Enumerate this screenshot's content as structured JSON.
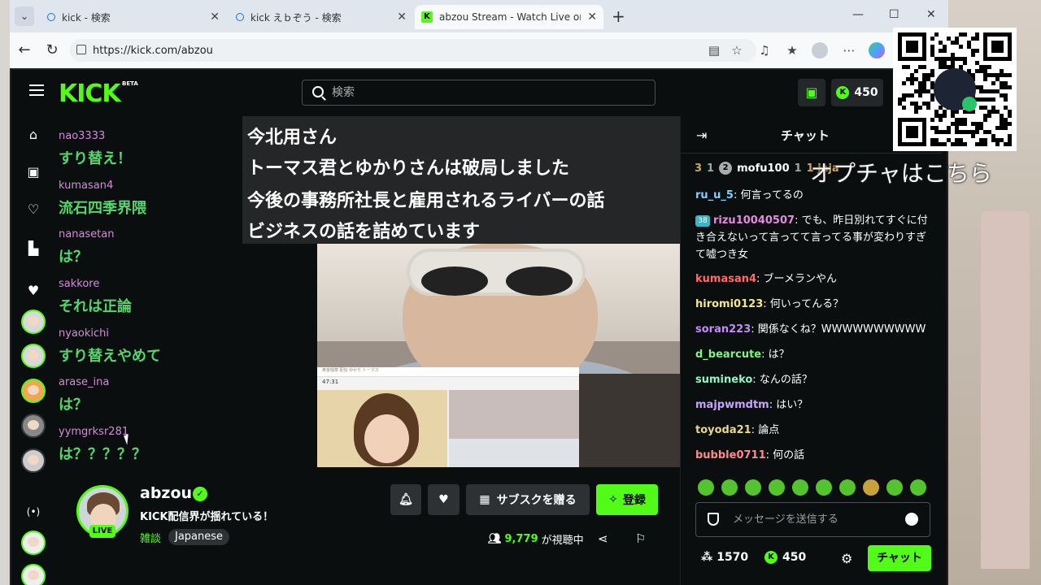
{
  "browser": {
    "tabs": [
      {
        "title": "kick - 検索",
        "active": false
      },
      {
        "title": "kick えｂぞう - 検索",
        "active": false
      },
      {
        "title": "abzou Stream - Watch Live on Kick",
        "active": true
      }
    ],
    "new_tab": "+",
    "url": "https://kick.com/abzou",
    "window_controls": [
      "—",
      "☐",
      "✕"
    ]
  },
  "header": {
    "logo": "KICK",
    "beta": "BETA",
    "search_placeholder": "検索",
    "kicks_balance": "450",
    "kick_coin": "K"
  },
  "overlay_chat": [
    {
      "user": "nao3333",
      "message": "すり替え！"
    },
    {
      "user": "kumasan4",
      "message": "流石四季界隈"
    },
    {
      "user": "nanasetan",
      "message": "は？"
    },
    {
      "user": "sakkore",
      "message": "それは正論"
    },
    {
      "user": "nyaokichi",
      "message": "すり替えやめて"
    },
    {
      "user": "arase_ina",
      "message": "は？"
    },
    {
      "user": "yymgrksr281",
      "message": "は？？？？？"
    }
  ],
  "caption": {
    "lines": [
      "今北用さん",
      "トーマス君とゆかりさんは破局しました",
      "今後の事務所社長と雇用されるライバーの話",
      "ビジネスの話を詰めています"
    ]
  },
  "video": {
    "screenshot_time": "47:31",
    "screenshot_title": "奥宮瑠菜 配信 ゆかり トーマス"
  },
  "stream": {
    "streamer": "abzou",
    "live_badge": "LIVE",
    "title": "KICK配信界が揺れている！",
    "category": "雑談",
    "language": "Japanese",
    "subscribe_gift_label": "サブスクを贈る",
    "follow_label": "登録",
    "viewers_count": "9,779",
    "viewers_label": "が視聴中"
  },
  "chat": {
    "title": "チャット",
    "pinned": {
      "rank": "3",
      "count1": "1",
      "badge": "2",
      "user": "mofu100",
      "count2": "1",
      "extra": "1 jaja"
    },
    "messages": [
      {
        "user": "ru_u_5",
        "text": "何言ってるの",
        "color": "#7fd1ff"
      },
      {
        "user": "rizu10040507",
        "text": "でも、昨日別れてすぐに付き合えないって言ってて言ってる事が変わりすぎて嘘つき女",
        "color": "#e58ae0",
        "badge": "38"
      },
      {
        "user": "kumasan4",
        "text": "ブーメランやん",
        "color": "#ff6b6b"
      },
      {
        "user": "hiromi0123",
        "text": "何いってんる？",
        "color": "#f3e88a"
      },
      {
        "user": "soran223",
        "text": "関係なくね？WWWWWWWWWW",
        "color": "#c38bf7"
      },
      {
        "user": "d_bearcute",
        "text": "は？",
        "color": "#7ff57f"
      },
      {
        "user": "sumineko",
        "text": "なんの話？",
        "color": "#8df7c9"
      },
      {
        "user": "majpwmdtm",
        "text": "はい？",
        "color": "#c7a3ff"
      },
      {
        "user": "toyoda21",
        "text": "論点",
        "color": "#e6d98a"
      },
      {
        "user": "bubble0711",
        "text": "何の話",
        "color": "#ff8a8a"
      }
    ],
    "input_placeholder": "メッセージを送信する",
    "points": "1570",
    "kicks": "450",
    "send_label": "チャット"
  },
  "qr_overlay": {
    "label": "オプチャはこちら"
  },
  "colors": {
    "kick_green": "#53fc18",
    "bg": "#0b0e0f",
    "panel": "#2e3134"
  }
}
